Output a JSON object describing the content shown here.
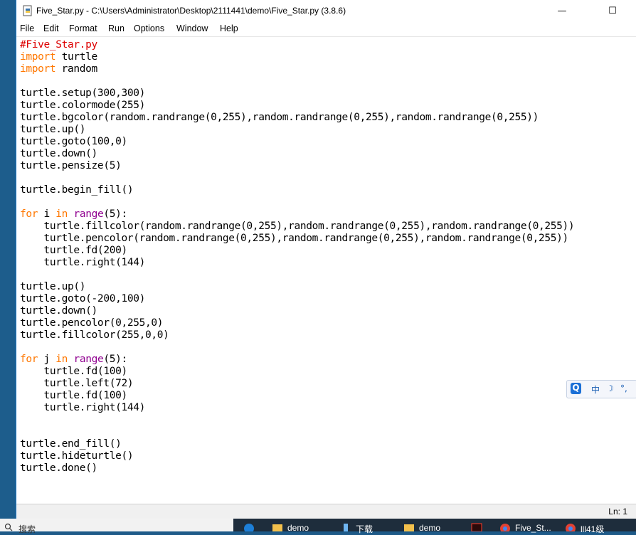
{
  "window": {
    "title": "Five_Star.py - C:\\Users\\Administrator\\Desktop\\2111441\\demo\\Five_Star.py (3.8.6)",
    "minimize_glyph": "—",
    "maximize_glyph": "☐"
  },
  "menu": [
    "File",
    "Edit",
    "Format",
    "Run",
    "Options",
    "Window",
    "Help"
  ],
  "code_lines": [
    [
      {
        "t": "#Five_Star.py",
        "c": "cm"
      }
    ],
    [
      {
        "t": "import",
        "c": "kw"
      },
      {
        "t": " turtle"
      }
    ],
    [
      {
        "t": "import",
        "c": "kw"
      },
      {
        "t": " random"
      }
    ],
    [],
    [
      {
        "t": "turtle.setup(300,300)"
      }
    ],
    [
      {
        "t": "turtle.colormode(255)"
      }
    ],
    [
      {
        "t": "turtle.bgcolor(random.randrange(0,255),random.randrange(0,255),random.randrange(0,255))"
      }
    ],
    [
      {
        "t": "turtle.up()"
      }
    ],
    [
      {
        "t": "turtle.goto(100,0)"
      }
    ],
    [
      {
        "t": "turtle.down()"
      }
    ],
    [
      {
        "t": "turtle.pensize(5)"
      }
    ],
    [],
    [
      {
        "t": "turtle.begin_fill()"
      }
    ],
    [],
    [
      {
        "t": "for",
        "c": "kw"
      },
      {
        "t": " i "
      },
      {
        "t": "in",
        "c": "kw"
      },
      {
        "t": " "
      },
      {
        "t": "range",
        "c": "bi"
      },
      {
        "t": "(5):"
      }
    ],
    [
      {
        "t": "    turtle.fillcolor(random.randrange(0,255),random.randrange(0,255),random.randrange(0,255))"
      }
    ],
    [
      {
        "t": "    turtle.pencolor(random.randrange(0,255),random.randrange(0,255),random.randrange(0,255))"
      }
    ],
    [
      {
        "t": "    turtle.fd(200)"
      }
    ],
    [
      {
        "t": "    turtle.right(144)"
      }
    ],
    [],
    [
      {
        "t": "turtle.up()"
      }
    ],
    [
      {
        "t": "turtle.goto(-200,100)"
      }
    ],
    [
      {
        "t": "turtle.down()"
      }
    ],
    [
      {
        "t": "turtle.pencolor(0,255,0)"
      }
    ],
    [
      {
        "t": "turtle.fillcolor(255,0,0)"
      }
    ],
    [],
    [
      {
        "t": "for",
        "c": "kw"
      },
      {
        "t": " j "
      },
      {
        "t": "in",
        "c": "kw"
      },
      {
        "t": " "
      },
      {
        "t": "range",
        "c": "bi"
      },
      {
        "t": "(5):"
      }
    ],
    [
      {
        "t": "    turtle.fd(100)"
      }
    ],
    [
      {
        "t": "    turtle.left(72)"
      }
    ],
    [
      {
        "t": "    turtle.fd(100)"
      }
    ],
    [
      {
        "t": "    turtle.right(144)"
      }
    ],
    [],
    [],
    [
      {
        "t": "turtle.end_fill()"
      }
    ],
    [
      {
        "t": "turtle.hideturtle()"
      }
    ],
    [
      {
        "t": "turtle.done()"
      }
    ]
  ],
  "status": {
    "position": "Ln: 1"
  },
  "ime": {
    "logo": "Q",
    "mode": "中",
    "moon": "☽",
    "punct": "°,",
    "extra": "⌨"
  },
  "taskbar": {
    "search": "搜索",
    "items": [
      {
        "icon": "edge-icon",
        "label": ""
      },
      {
        "icon": "folder-icon",
        "label": "demo"
      },
      {
        "icon": "download-icon",
        "label": "下载"
      },
      {
        "icon": "folder-icon",
        "label": "demo"
      },
      {
        "icon": "adobe-icon",
        "label": ""
      },
      {
        "icon": "chrome-icon",
        "label": "Five_St..."
      },
      {
        "icon": "chrome-icon",
        "label": "lll41级"
      }
    ]
  },
  "colors": {
    "keyword": "#ff7700",
    "builtin": "#900090",
    "comment": "#dd0000",
    "desktop": "#1e5a88"
  }
}
